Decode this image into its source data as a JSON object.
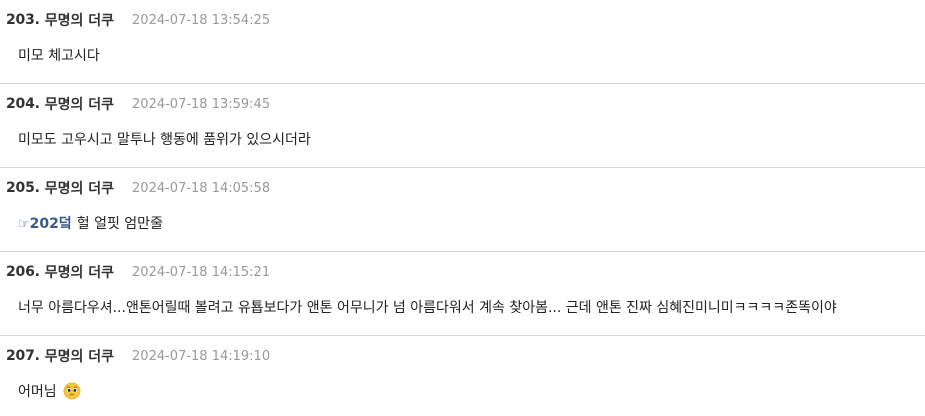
{
  "comments": [
    {
      "num": "203.",
      "author": "무명의 더쿠",
      "timestamp": "2024-07-18 13:54:25",
      "text": "미모 체고시다"
    },
    {
      "num": "204.",
      "author": "무명의 더쿠",
      "timestamp": "2024-07-18 13:59:45",
      "text": "미모도 고우시고 말투나 행동에 품위가 있으시더라"
    },
    {
      "num": "205.",
      "author": "무명의 더쿠",
      "timestamp": "2024-07-18 14:05:58",
      "reply_icon": "☞",
      "reply_to": "202덬",
      "text": "헐 얼핏 엄만줄"
    },
    {
      "num": "206.",
      "author": "무명의 더쿠",
      "timestamp": "2024-07-18 14:15:21",
      "text": "너무 아름다우셔...앤톤어릴때 볼려고 유툡보다가 앤톤 어무니가 넘 아름다워서 계속 찾아봄... 근데 앤톤 진짜 심혜진미니미ㅋㅋㅋㅋ존똑이야"
    },
    {
      "num": "207.",
      "author": "무명의 더쿠",
      "timestamp": "2024-07-18 14:19:10",
      "text": "어머님",
      "emoji": "pleading-face-emoji"
    }
  ]
}
